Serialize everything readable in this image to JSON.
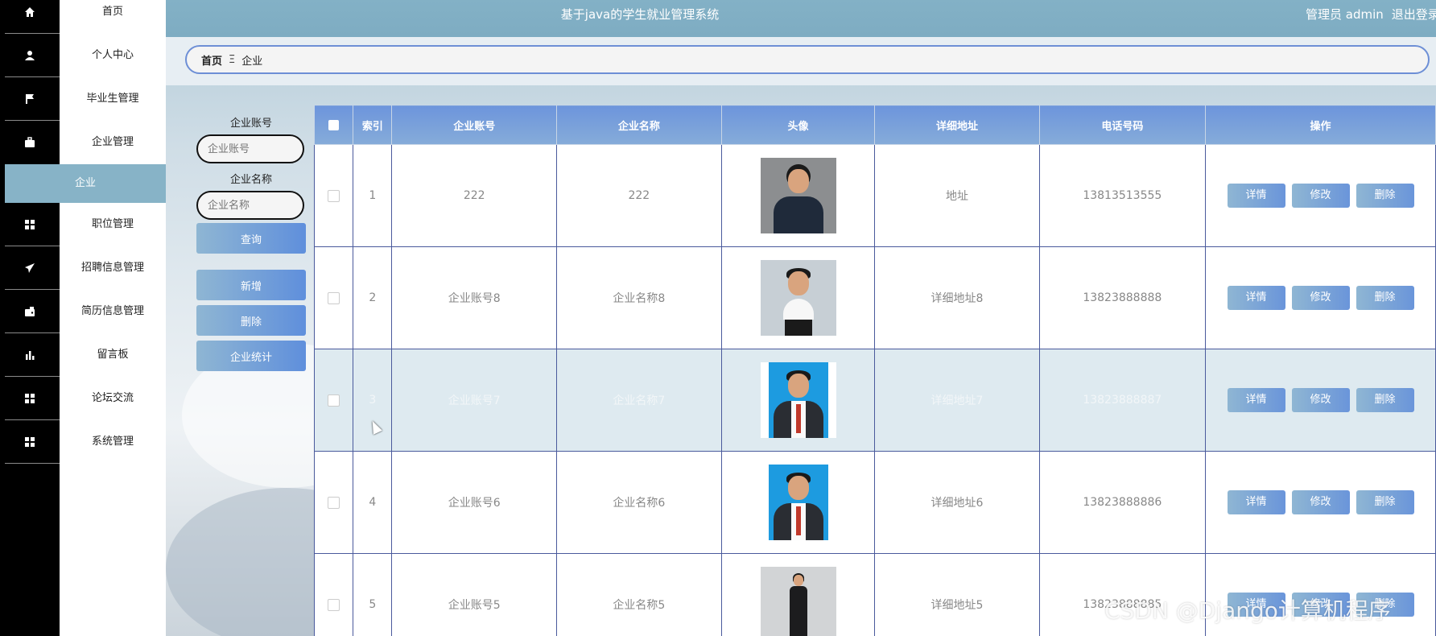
{
  "header": {
    "title": "基于java的学生就业管理系统",
    "user": "管理员 admin",
    "logout": "退出登录"
  },
  "sidebar": {
    "items": [
      {
        "label": "首页",
        "icon": "home-icon"
      },
      {
        "label": "个人中心",
        "icon": "user-icon"
      },
      {
        "label": "毕业生管理",
        "icon": "flag-icon"
      },
      {
        "label": "企业管理",
        "icon": "briefcase-icon"
      },
      {
        "label": "企业",
        "icon": ""
      },
      {
        "label": "职位管理",
        "icon": "grid-icon"
      },
      {
        "label": "招聘信息管理",
        "icon": "paper-plane-icon"
      },
      {
        "label": "简历信息管理",
        "icon": "wallet-icon"
      },
      {
        "label": "留言板",
        "icon": "bar-chart-icon"
      },
      {
        "label": "论坛交流",
        "icon": "grid-icon"
      },
      {
        "label": "系统管理",
        "icon": "grid-icon"
      }
    ]
  },
  "breadcrumb": {
    "home": "首页",
    "separator": "Ξ",
    "current": "企业"
  },
  "search": {
    "account_label": "企业账号",
    "account_placeholder": "企业账号",
    "name_label": "企业名称",
    "name_placeholder": "企业名称",
    "query_button": "查询",
    "add_button": "新增",
    "delete_button": "删除",
    "stats_button": "企业统计"
  },
  "table": {
    "headers": [
      "索引",
      "企业账号",
      "企业名称",
      "头像",
      "详细地址",
      "电话号码",
      "操作"
    ],
    "rows": [
      {
        "index": "1",
        "account": "222",
        "name": "222",
        "address": "地址",
        "phone": "13813513555"
      },
      {
        "index": "2",
        "account": "企业账号8",
        "name": "企业名称8",
        "address": "详细地址8",
        "phone": "13823888888"
      },
      {
        "index": "3",
        "account": "企业账号7",
        "name": "企业名称7",
        "address": "详细地址7",
        "phone": "13823888887"
      },
      {
        "index": "4",
        "account": "企业账号6",
        "name": "企业名称6",
        "address": "详细地址6",
        "phone": "13823888886"
      },
      {
        "index": "5",
        "account": "企业账号5",
        "name": "企业名称5",
        "address": "详细地址5",
        "phone": "13823888885"
      }
    ],
    "actions": {
      "detail": "详情",
      "edit": "修改",
      "delete": "删除"
    }
  },
  "watermark": "CSDN @Django计算机程序",
  "colors": {
    "topbar": "#83b1c6",
    "active_item": "#87b3c7",
    "button_start": "#8fb6d3",
    "button_end": "#5f8fdc",
    "table_header": "#6d95dc",
    "highlight_row": "#deeaf0"
  }
}
